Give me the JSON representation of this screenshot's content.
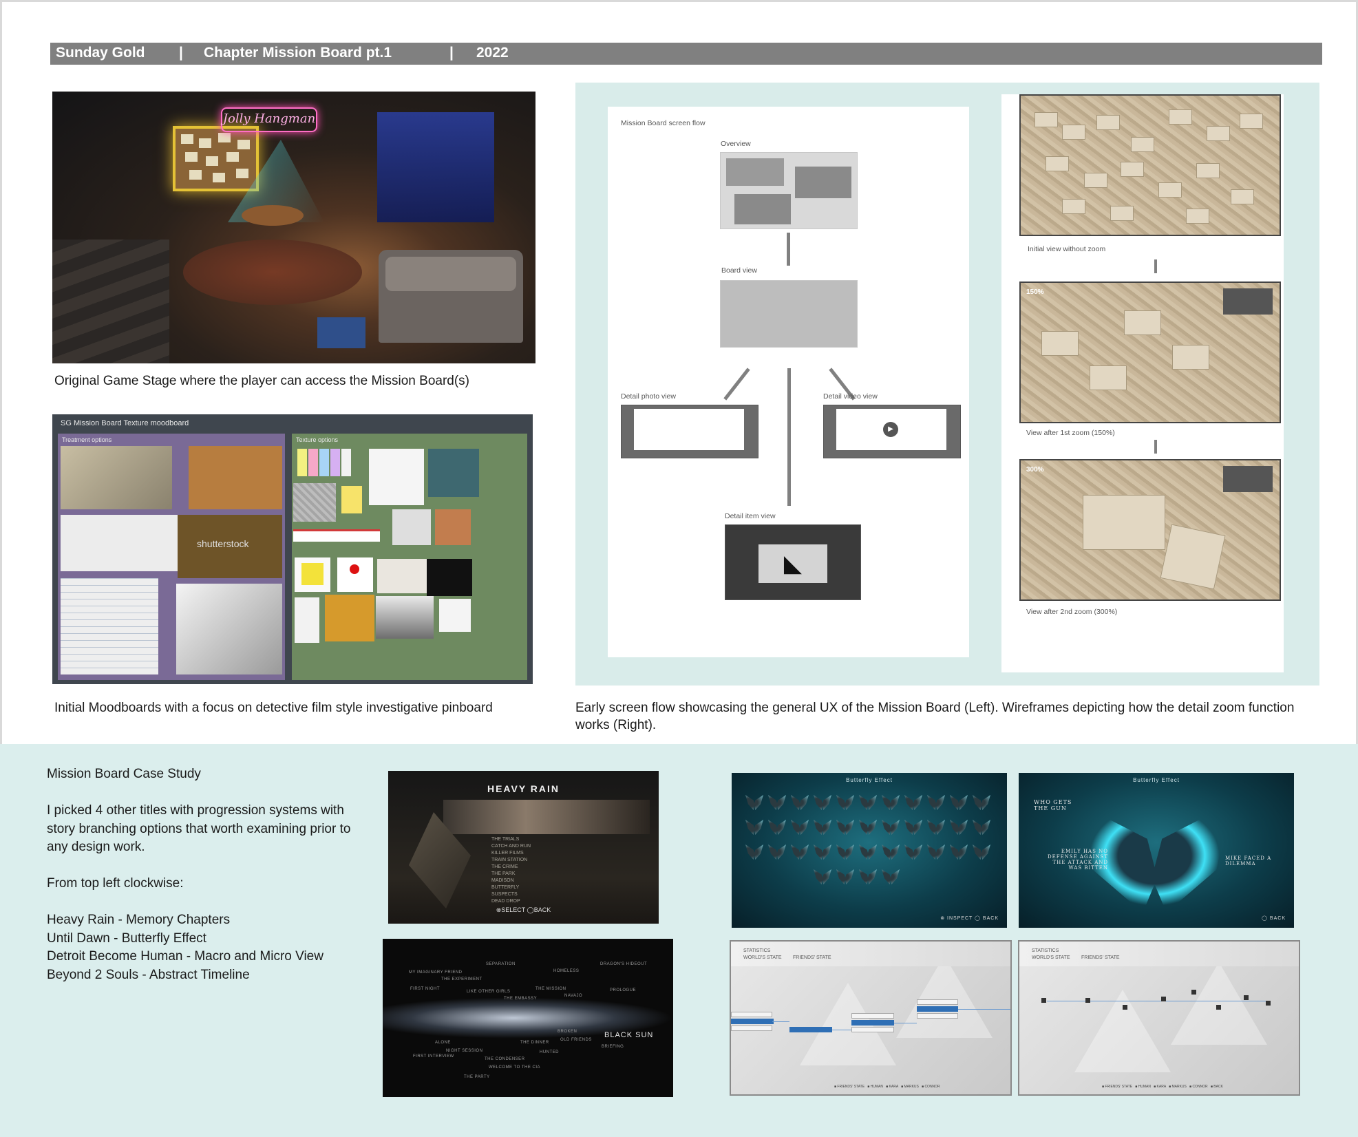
{
  "header": {
    "project": "Sunday Gold",
    "sep1": "|",
    "board": "Chapter Mission Board pt.1",
    "sep2": "|",
    "year": "2022"
  },
  "captions": {
    "game_stage": "Original Game Stage where the player can access the Mission Board(s)",
    "moodboard": "Initial Moodboards with a focus on detective film style investigative pinboard",
    "screen_flow": "Early screen flow showcasing the general UX of the Mission Board (Left).  Wireframes depicting how the detail zoom function works (Right)."
  },
  "game_stage": {
    "neon_sign": "Jolly Hangman"
  },
  "moodboard": {
    "title": "SG Mission Board Texture moodboard",
    "left_label": "Treatment options",
    "right_label": "Texture options",
    "watermark": "shutterstock"
  },
  "screen_flow": {
    "title": "Mission Board screen flow",
    "overview": "Overview",
    "board_view": "Board view",
    "detail_photo": "Detail photo view",
    "detail_video": "Detail video view",
    "detail_item": "Detail item view"
  },
  "wireframes": {
    "initial": "Initial view without zoom",
    "zoom1": "View after 1st zoom (150%)",
    "zoom2": "View after 2nd zoom (300%)",
    "zoom1_level": "150%",
    "zoom2_level": "300%"
  },
  "case_study": {
    "title": "Mission Board Case Study",
    "intro": "I picked 4 other titles with progression systems with story branching options that worth examining prior to any design work.",
    "order": "From top left clockwise:",
    "titles": [
      "Heavy Rain - Memory Chapters",
      "Until Dawn - Butterfly Effect",
      "Detroit Become Human - Macro and Micro View",
      "Beyond 2 Souls - Abstract Timeline"
    ]
  },
  "heavy_rain": {
    "logo": "HEAVY RAIN",
    "menu": [
      "THE TRIALS",
      "CATCH AND RUN",
      "KILLER FILMS",
      "TRAIN STATION",
      "THE CRIME",
      "THE PARK",
      "MADISON",
      "BUTTERFLY",
      "SUSPECTS",
      "DEAD DROP"
    ],
    "footer": "⊗SELECT ◯BACK"
  },
  "until_dawn": {
    "header": "Butterfly Effect",
    "question": "WHO GETS THE GUN",
    "left_text": "EMILY HAS NO DEFENSE AGAINST THE ATTACK AND WAS BITTEN",
    "right_text": "MIKE FACED A DILEMMA",
    "footer_left": "⊗ INSPECT   ◯ BACK",
    "footer_right": "◯ BACK"
  },
  "detroit": {
    "stats_title": "STATISTICS",
    "world": "WORLD'S STATE",
    "friends": "FRIENDS' STATE"
  },
  "beyond": {
    "timeline": [
      "MY IMAGINARY FRIEND",
      "THE EXPERIMENT",
      "FIRST NIGHT",
      "SEPARATION",
      "LIKE OTHER GIRLS",
      "THE EMBASSY",
      "THE MISSION",
      "HOMELESS",
      "DRAGON'S HIDEOUT",
      "NAVAJO",
      "PROLOGUE",
      "HUNTED",
      "ALONE",
      "NIGHT SESSION",
      "THE DINNER",
      "OLD FRIENDS",
      "BRIEFING",
      "FIRST INTERVIEW",
      "THE CONDENSER",
      "WELCOME TO THE CIA",
      "THE PARTY",
      "BROKEN"
    ],
    "highlight": "BLACK SUN"
  },
  "colors": {
    "header_bar": "#808080",
    "flow_bg": "#d9ecea",
    "bottom_bg": "#dbeeed",
    "wire_arrow": "#808080"
  }
}
